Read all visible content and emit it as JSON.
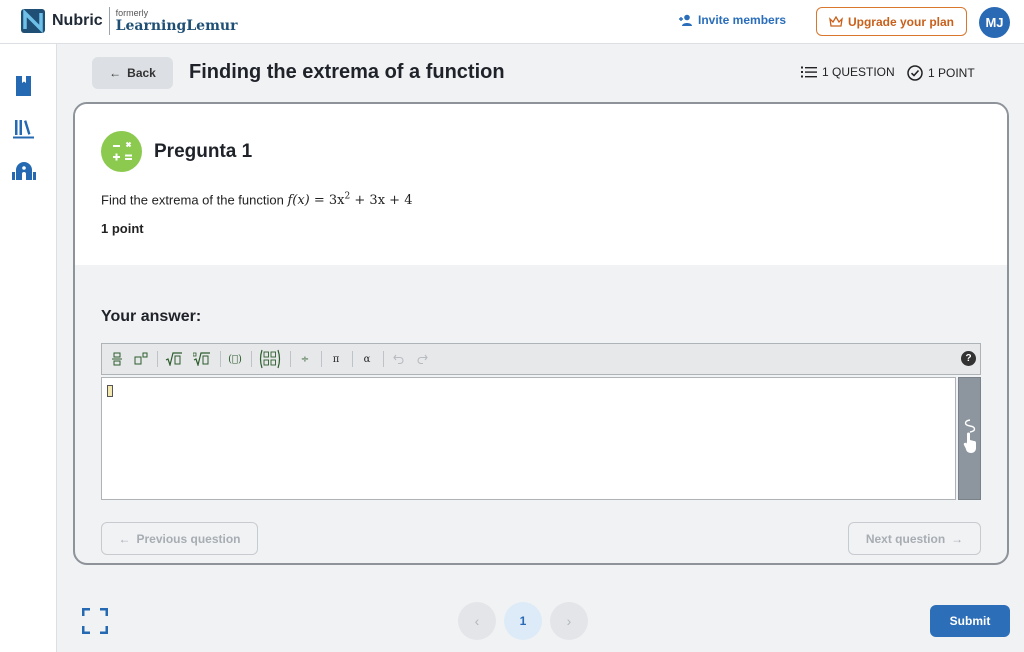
{
  "brand": {
    "name": "Nubric",
    "formerly": "formerly",
    "old_name": "LearningLemur"
  },
  "topbar": {
    "invite_label": "Invite members",
    "upgrade_label": "Upgrade your plan",
    "avatar_initials": "MJ"
  },
  "header": {
    "back_label": "Back",
    "title": "Finding the extrema of a function",
    "question_count": "1 QUESTION",
    "point_count": "1 POINT"
  },
  "question": {
    "title": "Pregunta 1",
    "text_prefix": "Find the extrema of the function",
    "formula_fx": "f(x)",
    "formula_eq": "= 3x",
    "formula_exp": "2",
    "formula_rest": "+ 3x + 4",
    "points": "1 point"
  },
  "answer": {
    "label": "Your answer:"
  },
  "toolbar": {
    "pi": "π",
    "alpha": "α",
    "divide": "÷",
    "paren": "(⃞)",
    "help": "?"
  },
  "nav": {
    "prev_label": "Previous question",
    "next_label": "Next question"
  },
  "pagination": {
    "prev": "‹",
    "current": "1",
    "next": "›"
  },
  "footer": {
    "submit_label": "Submit"
  },
  "colors": {
    "accent": "#2d6eb8",
    "upgrade": "#c8601c",
    "question_icon": "#8bc94f"
  }
}
